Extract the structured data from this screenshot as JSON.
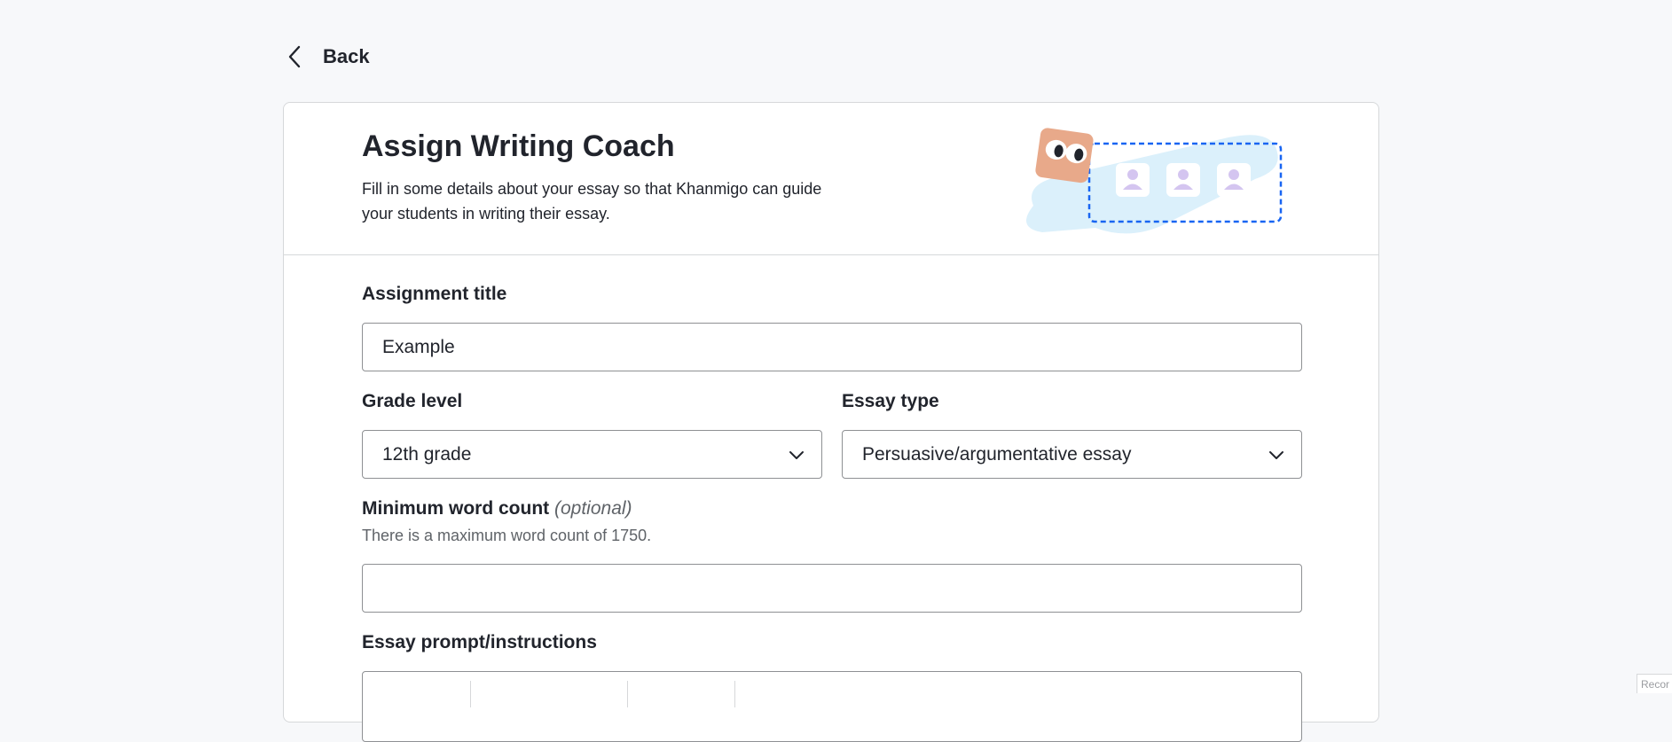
{
  "nav": {
    "back_label": "Back"
  },
  "header": {
    "title": "Assign Writing Coach",
    "description": "Fill in some details about your essay so that Khanmigo can guide your students in writing their essay."
  },
  "form": {
    "assignment_title": {
      "label": "Assignment title",
      "value": "Example"
    },
    "grade_level": {
      "label": "Grade level",
      "selected": "12th grade"
    },
    "essay_type": {
      "label": "Essay type",
      "selected": "Persuasive/argumentative essay"
    },
    "min_word_count": {
      "label": "Minimum word count",
      "optional_tag": "(optional)",
      "hint": "There is a maximum word count of 1750.",
      "value": ""
    },
    "essay_prompt": {
      "label": "Essay prompt/instructions"
    }
  },
  "colors": {
    "page_bg": "#f7f8fa",
    "card_border": "#d6d8da",
    "accent_blue": "#1865f2",
    "light_blue": "#dbf0fb",
    "avatar_purple": "#d4c5f0",
    "mascot_peach": "#e8a98a"
  },
  "corner_tag": "Recor"
}
